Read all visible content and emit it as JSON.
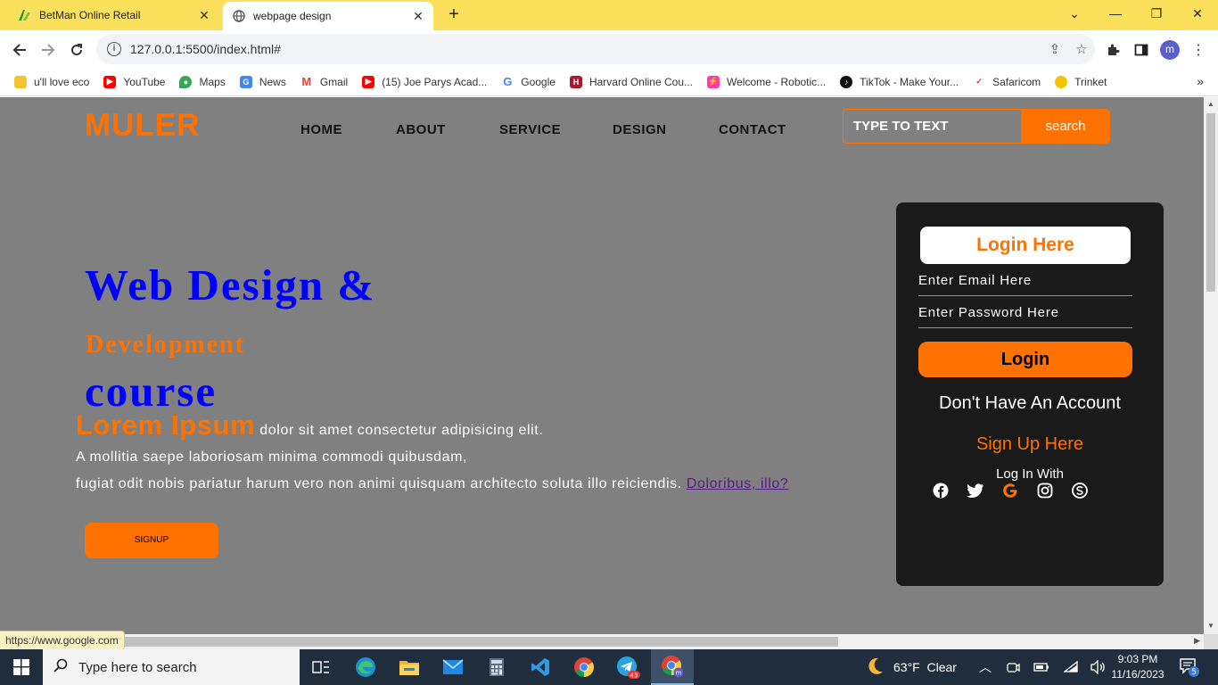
{
  "browser": {
    "tabs": [
      {
        "title": "BetMan Online Retail"
      },
      {
        "title": "webpage design"
      }
    ],
    "url": "127.0.0.1:5500/index.html#",
    "bookmarks": [
      {
        "label": "u'll love eco",
        "icon": "folder-icon",
        "color": "#f4c430"
      },
      {
        "label": "YouTube",
        "icon": "youtube-icon",
        "color": "#ff0000"
      },
      {
        "label": "Maps",
        "icon": "maps-icon",
        "color": "#34a853"
      },
      {
        "label": "News",
        "icon": "news-icon",
        "color": "#4285f4"
      },
      {
        "label": "Gmail",
        "icon": "gmail-icon",
        "color": "#ea4335"
      },
      {
        "label": "(15) Joe Parys Acad...",
        "icon": "youtube-icon",
        "color": "#ff0000"
      },
      {
        "label": "Google",
        "icon": "google-icon",
        "color": "#4285f4"
      },
      {
        "label": "Harvard Online Cou...",
        "icon": "harvard-icon",
        "color": "#a51c30"
      },
      {
        "label": "Welcome - Robotic...",
        "icon": "robotics-icon",
        "color": "#ff3ea5"
      },
      {
        "label": "TikTok - Make Your...",
        "icon": "tiktok-icon",
        "color": "#111111"
      },
      {
        "label": "Safaricom",
        "icon": "safaricom-icon",
        "color": "#e53935"
      },
      {
        "label": "Trinket",
        "icon": "trinket-icon",
        "color": "#f5c400"
      }
    ],
    "status_url": "https://www.google.com"
  },
  "page": {
    "logo": "MULER",
    "nav": [
      "HOME",
      "ABOUT",
      "SERVICE",
      "DESIGN",
      "CONTACT"
    ],
    "search": {
      "placeholder": "TYPE TO TEXT",
      "button": "search"
    },
    "heading_line1": "Web Design &",
    "heading_line2": "Development",
    "heading_line3": "course",
    "lorem_big": "Lorem Ipsum",
    "lorem_text1": " dolor sit amet consectetur adipisicing elit.",
    "lorem_text2": "A mollitia saepe laboriosam minima commodi quibusdam,",
    "lorem_text3": "fugiat odit nobis pariatur harum vero non animi quisquam architecto soluta illo reiciendis.",
    "lorem_link": "Doloribus, illo?",
    "signup_button": "SIGNUP",
    "accent": "#ff7200",
    "heading_color": "#0000ff"
  },
  "login_form": {
    "title": "Login Here",
    "email_placeholder": "Enter Email Here",
    "password_placeholder": "Enter Password Here",
    "button": "Login",
    "no_account": "Don't Have An Account",
    "signup_link": "Sign Up Here",
    "login_with": "Log In With",
    "social": [
      "facebook-icon",
      "twitter-icon",
      "google-icon",
      "instagram-icon",
      "skype-icon"
    ]
  },
  "taskbar": {
    "search_placeholder": "Type here to search",
    "telegram_badge": "43",
    "weather": "63°F  Clear",
    "time": "9:03 PM",
    "date": "11/16/2023",
    "notifications": "5"
  }
}
